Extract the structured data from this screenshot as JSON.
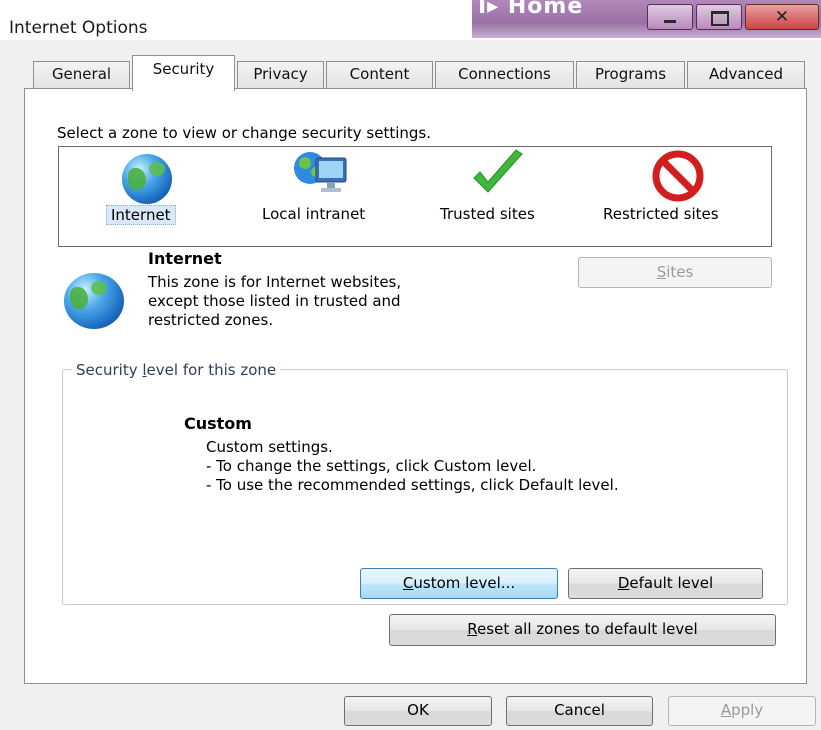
{
  "window": {
    "title": "Internet Options",
    "background_title": "Home"
  },
  "tabs": [
    {
      "label": "General"
    },
    {
      "label": "Security"
    },
    {
      "label": "Privacy"
    },
    {
      "label": "Content"
    },
    {
      "label": "Connections"
    },
    {
      "label": "Programs"
    },
    {
      "label": "Advanced"
    }
  ],
  "active_tab": "Security",
  "zones": {
    "prompt": "Select a zone to view or change security settings.",
    "items": [
      {
        "label": "Internet",
        "icon": "globe-icon",
        "selected": true
      },
      {
        "label": "Local intranet",
        "icon": "network-computer-icon",
        "selected": false
      },
      {
        "label": "Trusted sites",
        "icon": "checkmark-icon",
        "selected": false
      },
      {
        "label": "Restricted sites",
        "icon": "no-entry-icon",
        "selected": false
      }
    ]
  },
  "selected_zone": {
    "title": "Internet",
    "description_lines": [
      "This zone is for Internet websites,",
      "except those listed in trusted and",
      "restricted zones."
    ],
    "sites_button": {
      "label": "Sites",
      "accel": "S",
      "rest": "ites",
      "enabled": false
    }
  },
  "security_level": {
    "group_label_pre": "Security ",
    "group_label_accel": "l",
    "group_label_post": "evel for this zone",
    "level_name": "Custom",
    "lines": [
      "Custom settings.",
      "- To change the settings, click Custom level.",
      "- To use the recommended settings, click Default level."
    ],
    "custom_button": {
      "accel": "C",
      "rest": "ustom level..."
    },
    "default_button": {
      "accel": "D",
      "rest": "efault level"
    }
  },
  "reset_button": {
    "accel": "R",
    "rest": "eset all zones to default level"
  },
  "footer": {
    "ok": "OK",
    "cancel": "Cancel",
    "apply_accel": "A",
    "apply_rest": "pply",
    "apply_enabled": false
  },
  "colors": {
    "selection": "#d8e8f8",
    "check_green": "#3cb83c",
    "stop_red": "#d21e1e",
    "title_bar_purple": "#9a70a6"
  }
}
